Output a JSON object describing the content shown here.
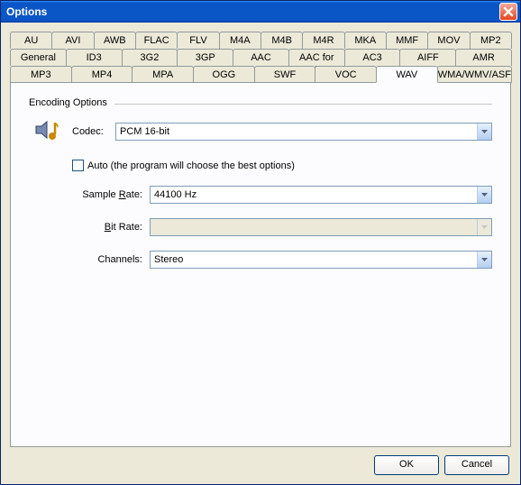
{
  "window": {
    "title": "Options"
  },
  "tabs": {
    "row1": [
      "AU",
      "AVI",
      "AWB",
      "FLAC",
      "FLV",
      "M4A",
      "M4B",
      "M4R",
      "MKA",
      "MMF",
      "MOV",
      "MP2"
    ],
    "row2": [
      "General",
      "ID3",
      "3G2",
      "3GP",
      "AAC",
      "AAC for iPod/DSi",
      "AC3",
      "AIFF",
      "AMR"
    ],
    "row3": [
      "MP3",
      "MP4",
      "MPA",
      "OGG",
      "SWF",
      "VOC",
      "WAV",
      "WMA/WMV/ASF"
    ],
    "active": "WAV"
  },
  "encoding": {
    "group_label": "Encoding Options",
    "codec_label": "Codec:",
    "codec_value": "PCM 16-bit",
    "auto_label": "Auto (the program will choose the best options)",
    "sample_rate_label_pre": "Sample ",
    "sample_rate_label_u": "R",
    "sample_rate_label_post": "ate:",
    "sample_rate_value": "44100 Hz",
    "bit_rate_label_u": "B",
    "bit_rate_label_post": "it Rate:",
    "bit_rate_value": "",
    "channels_label": "Channels:",
    "channels_value": "Stereo"
  },
  "buttons": {
    "ok": "OK",
    "cancel": "Cancel"
  }
}
